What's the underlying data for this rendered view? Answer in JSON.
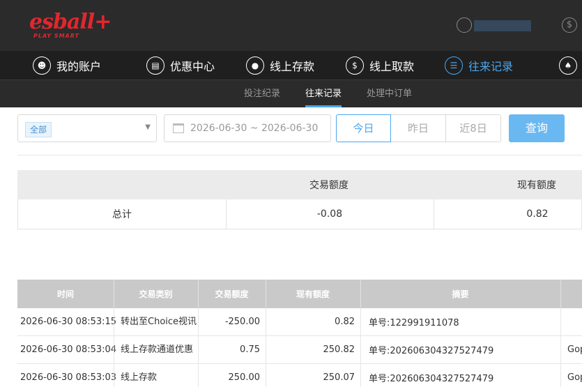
{
  "header": {
    "logo_text": "esball",
    "logo_plus": "+",
    "logo_tagline": "PLAY SMART",
    "dollar_symbol": "$"
  },
  "nav": {
    "items": [
      {
        "label": "我的账户",
        "icon": "user-icon"
      },
      {
        "label": "优惠中心",
        "icon": "gift-icon"
      },
      {
        "label": "线上存款",
        "icon": "deposit-icon"
      },
      {
        "label": "线上取款",
        "icon": "withdraw-icon"
      },
      {
        "label": "往来记录",
        "icon": "records-icon",
        "active": true
      },
      {
        "label": "",
        "icon": "bell-icon"
      }
    ]
  },
  "subnav": {
    "items": [
      {
        "label": "投注纪录"
      },
      {
        "label": "往来记录",
        "active": true
      },
      {
        "label": "处理中订单"
      }
    ]
  },
  "filters": {
    "type_selected": "全部",
    "date_range": "2026-06-30 ~ 2026-06-30",
    "quick": [
      "今日",
      "昨日",
      "近8日"
    ],
    "query_label": "查询"
  },
  "summary": {
    "headers": [
      "交易额度",
      "现有额度"
    ],
    "row_label": "总计",
    "transaction_amount": "-0.08",
    "current_amount": "0.82"
  },
  "records": {
    "headers": [
      "时间",
      "交易类别",
      "交易额度",
      "现有额度",
      "摘要"
    ],
    "rows": [
      {
        "time": "2026-06-30 08:53:15",
        "type": "转出至Choice视讯",
        "amount": "-250.00",
        "balance": "0.82",
        "memo": "单号:122991911078",
        "extra": ""
      },
      {
        "time": "2026-06-30 08:53:04",
        "type": "线上存款通道优惠",
        "amount": "0.75",
        "balance": "250.82",
        "memo": "单号:202606304327527479",
        "extra": "Gop"
      },
      {
        "time": "2026-06-30 08:53:03",
        "type": "线上存款",
        "amount": "250.00",
        "balance": "250.07",
        "memo": "单号:202606304327527479",
        "extra": "Gop"
      }
    ]
  },
  "colors": {
    "accent": "#4aa6f0",
    "brand": "#e3262d",
    "header_bg": "#2b2b2b"
  }
}
